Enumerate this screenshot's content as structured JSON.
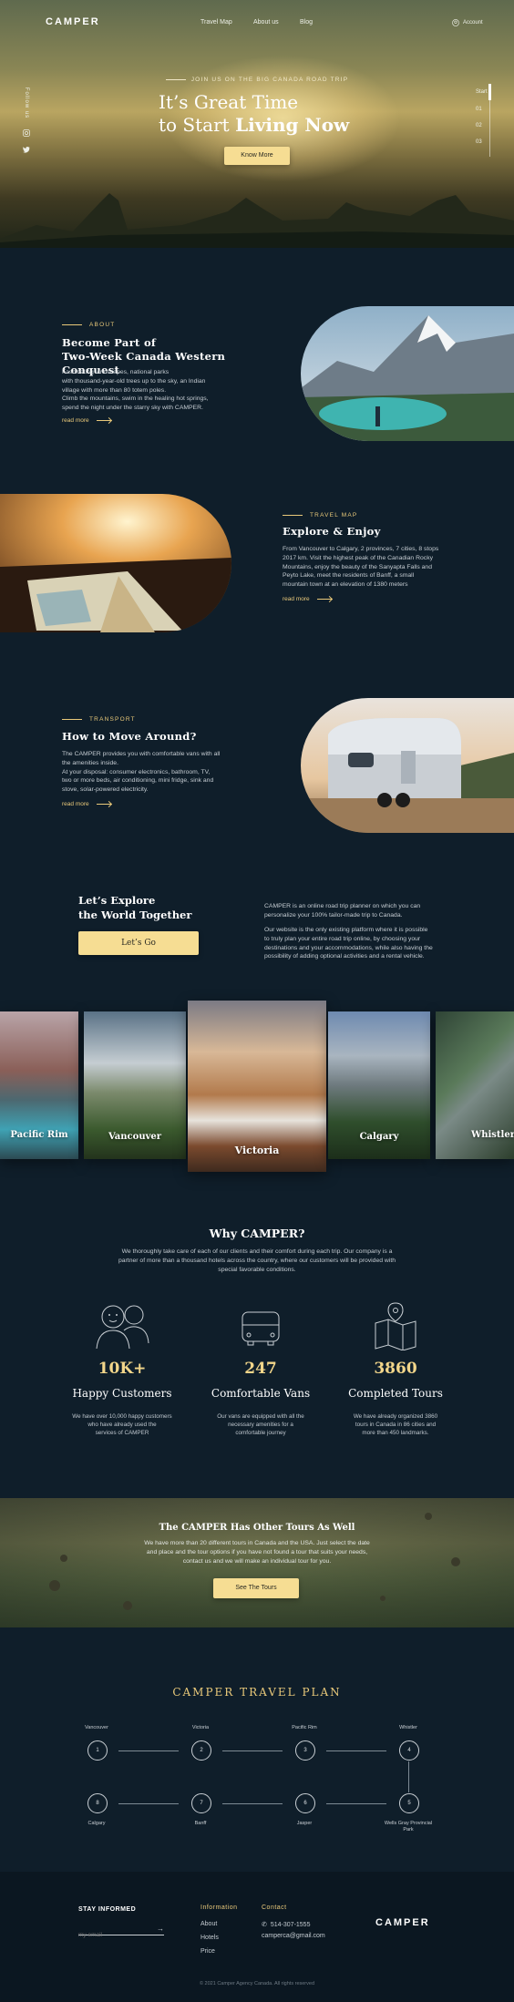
{
  "colors": {
    "background": "#0f1e2a",
    "accent": "#e9c97a",
    "button": "#f6dd93"
  },
  "nav": {
    "logo": "CAMPER",
    "items": [
      "Travel Map",
      "About us",
      "Blog"
    ],
    "account": "Account"
  },
  "social": {
    "follow_label": "Follow us",
    "icons": [
      "instagram-icon",
      "twitter-icon"
    ]
  },
  "hero": {
    "kicker": "JOIN US ON THE BIG CANADA ROAD TRIP",
    "title_line1": "It’s Great Time",
    "title_line2_prefix": "to Start ",
    "title_line2_bold": "Living Now",
    "button": "Know More",
    "pager": [
      "Start",
      "01",
      "02",
      "03"
    ]
  },
  "about": {
    "kicker": "ABOUT",
    "title_line1": "Become Part of",
    "title_line2": "Two-Week Canada Western Conquest",
    "text": [
      "Fascinating landscapes, national parks",
      "with thousand-year-old trees up to the sky, an Indian",
      "village with more than 80 totem poles.",
      "Climb the mountains, swim in the healing hot springs,",
      "spend the night under the starry sky with CAMPER."
    ],
    "read_more": "read more"
  },
  "travel_map": {
    "kicker": "TRAVEL MAP",
    "title": "Explore & Enjoy",
    "text": [
      "From Vancouver to Calgary, 2 provinces, 7 cities, 8 stops",
      "2017 km.  Visit the highest peak of the Canadian Rocky",
      "Mountains, enjoy the beauty of the Sanyapta Falls and",
      "Peyto Lake, meet the residents of Banff, a small",
      "mountain town at an elevation of 1380 meters"
    ],
    "read_more": "read more"
  },
  "transport": {
    "kicker": "TRANSPORT",
    "title": "How to Move Around?",
    "text": [
      "The CAMPER provides you with comfortable vans with all",
      "the amenities inside.",
      "At your disposal: consumer electronics, bathroom, TV,",
      "two or more beds, air conditioning, mini fridge, sink and",
      "stove, solar-powered electricity."
    ],
    "read_more": "read more"
  },
  "explore": {
    "title_line1": "Let’s Explore",
    "title_line2": "the World Together",
    "button": "Let’s Go",
    "text1": [
      "CAMPER is an online road trip planner on which you can",
      "personalize your 100% tailor-made trip to Canada."
    ],
    "text2": [
      "Our website is the only existing platform where it is possible",
      "to truly plan your entire road trip online, by choosing your",
      "destinations and your accommodations, while also having the",
      "possibility of adding optional activities and a rental vehicle."
    ]
  },
  "cities": [
    "Pacific Rim",
    "Vancouver",
    "Victoria",
    "Calgary",
    "Whistler"
  ],
  "why": {
    "title": "Why CAMPER?",
    "intro": [
      "We thoroughly take care of each of our clients and their comfort during each trip. Our company is a",
      "partner of more than a thousand hotels across the country, where our customers will be provided with",
      "special favorable conditions."
    ],
    "stats": [
      {
        "icon": "customers-icon",
        "value": "10K+",
        "label": "Happy Customers",
        "desc": [
          "We have over 10,000 happy customers",
          "who have already used the",
          "services of CAMPER"
        ]
      },
      {
        "icon": "van-icon",
        "value": "247",
        "label": "Comfortable Vans",
        "desc": [
          "Our vans are equipped with all the",
          "necessary amenities for a",
          "comfortable journey"
        ]
      },
      {
        "icon": "map-icon",
        "value": "3860",
        "label": "Completed Tours",
        "desc": [
          "We have already organized 3860",
          "tours in Canada in 86 cities and",
          "more than 450 landmarks."
        ]
      }
    ]
  },
  "other_tours": {
    "title": "The CAMPER Has Other Tours As Well",
    "text": [
      "We have more than 20 different tours in Canada and the USA. Just select the date",
      "and place and the tour options if you have not found a tour that suits your needs,",
      "contact us and we will make an individual tour for you."
    ],
    "button": "See The Tours"
  },
  "plan": {
    "title": "CAMPER TRAVEL PLAN",
    "top": [
      {
        "n": "1",
        "name": "Vancouver"
      },
      {
        "n": "2",
        "name": "Victoria"
      },
      {
        "n": "3",
        "name": "Pacific Rim"
      },
      {
        "n": "4",
        "name": "Whistler"
      }
    ],
    "bottom": [
      {
        "n": "8",
        "name": "Calgary"
      },
      {
        "n": "7",
        "name": "Banff"
      },
      {
        "n": "6",
        "name": "Jasper"
      },
      {
        "n": "5",
        "name": "Wells Gray Provincial Park"
      }
    ]
  },
  "footer": {
    "stay_informed": "STAY INFORMED",
    "email_placeholder": "my email",
    "info_head": "Information",
    "info_links": [
      "About",
      "Hotels",
      "Price"
    ],
    "contact_head": "Contact",
    "phone": "514-307-1555",
    "email": "camperca@gmail.com",
    "logo": "CAMPER",
    "copyright": "© 2021 Camper Agency Canada. All rights reserved"
  }
}
